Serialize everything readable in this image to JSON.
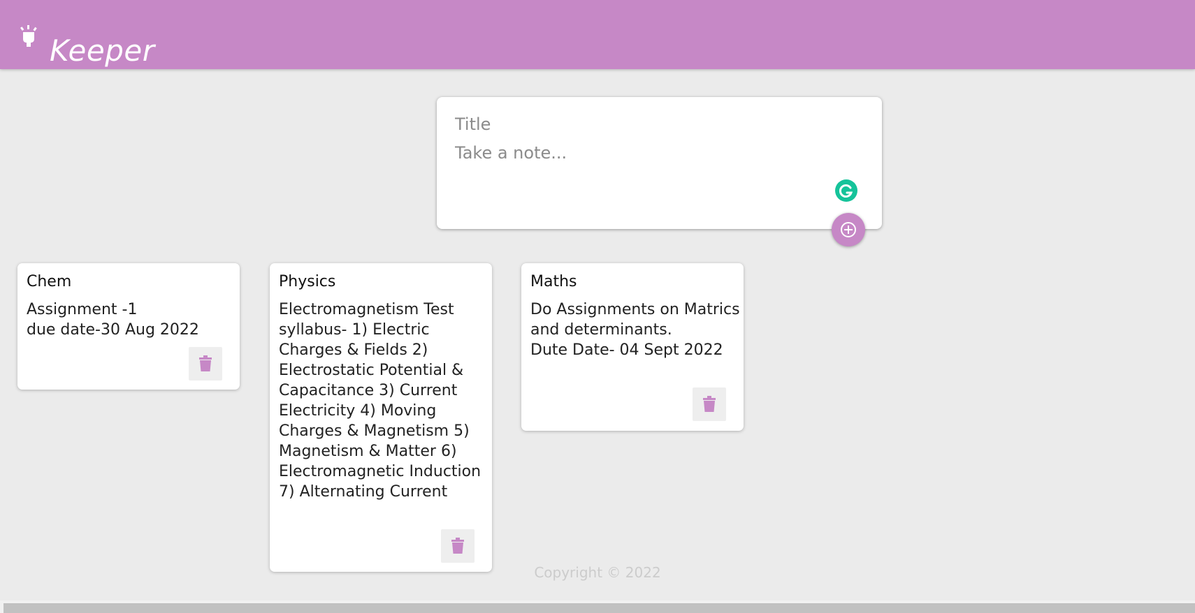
{
  "app": {
    "title": "Keeper",
    "logo_icon": "lightbulb-icon",
    "brand_color": "#c688c6"
  },
  "composer": {
    "title_placeholder": "Title",
    "content_placeholder": "Take a note...",
    "add_button_icon": "plus-icon",
    "grammarly_icon": "grammarly-icon"
  },
  "notes": [
    {
      "title": "Chem",
      "content": "Assignment -1\ndue date-30 Aug 2022",
      "delete_icon": "trash-icon"
    },
    {
      "title": "Physics",
      "content": "Electromagnetism Test syllabus- 1) Electric Charges & Fields 2) Electrostatic Potential & Capacitance 3) Current Electricity 4) Moving Charges & Magnetism 5) Magnetism & Matter 6) Electromagnetic Induction 7) Alternating Current",
      "delete_icon": "trash-icon"
    },
    {
      "title": "Maths",
      "content": "Do Assignments on Matrics and determinants.\nDute Date- 04 Sept 2022",
      "delete_icon": "trash-icon"
    }
  ],
  "footer": {
    "text": "Copyright © 2022"
  }
}
